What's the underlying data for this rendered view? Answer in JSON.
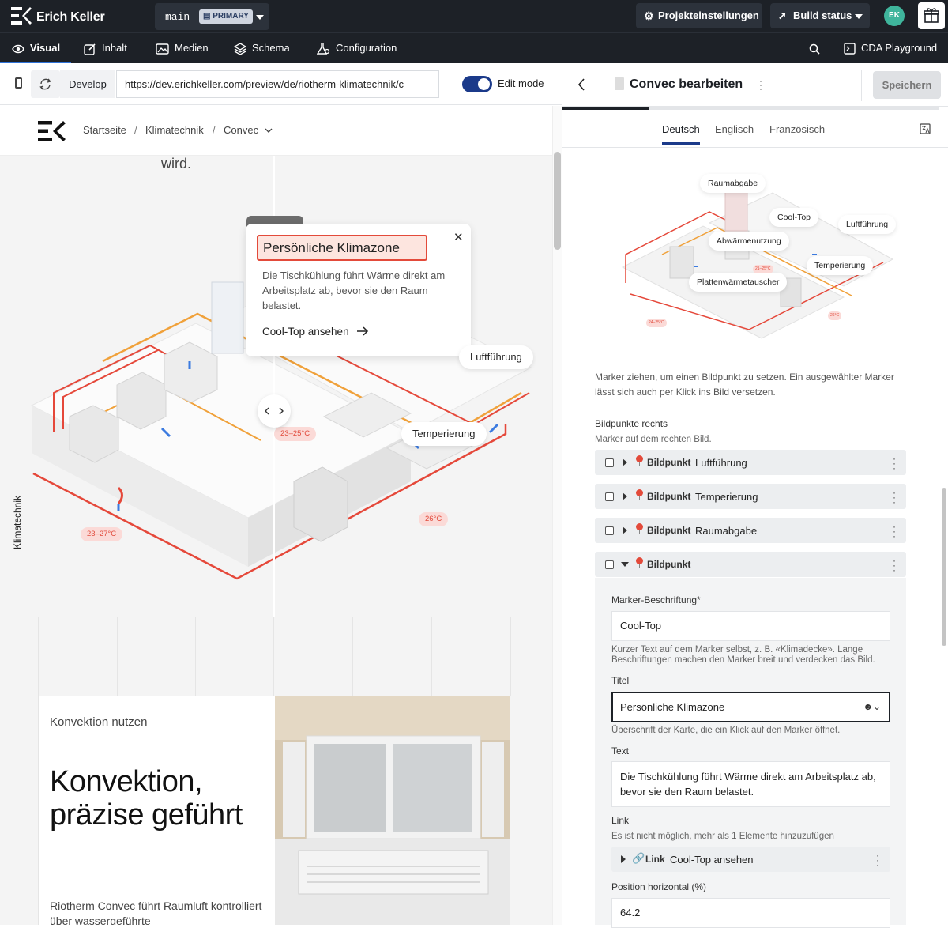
{
  "topbar": {
    "brand": "Erich Keller",
    "branch": "main",
    "branch_badge": "PRIMARY",
    "project_settings": "Projekteinstellungen",
    "build_status": "Build status",
    "avatar_initials": "EK"
  },
  "nav": {
    "items": [
      "Visual",
      "Inhalt",
      "Medien",
      "Schema",
      "Configuration"
    ],
    "cda": "CDA Playground"
  },
  "address": {
    "env": "Develop",
    "url": "https://dev.erichkeller.com/preview/de/riotherm-klimatechnik/c",
    "edit_mode": "Edit mode"
  },
  "preview": {
    "breadcrumb": [
      "Startseite",
      "Klimatechnik",
      "Convec"
    ],
    "intro_tail": "wird.",
    "side_label": "Klimatechnik",
    "popup": {
      "title": "Persönliche Klimazone",
      "text": "Die Tischkühlung führt Wärme direkt am Arbeitsplatz ab, bevor sie den Raum belastet.",
      "link": "Cool-Top ansehen"
    },
    "chips": [
      "Luftführung",
      "Temperierung"
    ],
    "temps": [
      "23–25°C",
      "23–27°C",
      "26°C"
    ],
    "section": {
      "eyebrow": "Konvektion nutzen",
      "headline": "Konvektion, präzise geführt",
      "body": "Riotherm Convec führt Raumluft kontrolliert über wassergeführte"
    }
  },
  "editor": {
    "title": "Convec bearbeiten",
    "save": "Speichern",
    "tabs": [
      "Deutsch",
      "Englisch",
      "Französisch"
    ],
    "thumb_labels": [
      "Raumabgabe",
      "Cool-Top",
      "Luftführung",
      "Abwärmenutzung",
      "Temperierung",
      "Plattenwärmetauscher"
    ],
    "thumb_temps": [
      "21–25°C",
      "24–25°C",
      "26°C"
    ],
    "hint": "Marker ziehen, um einen Bildpunkt zu setzen. Ein ausgewählter Marker lässt sich auch per Klick ins Bild versetzen.",
    "points_label": "Bildpunkte rechts",
    "points_sub": "Marker auf dem rechten Bild.",
    "point_kind": "Bildpunkt",
    "points": [
      "Luftführung",
      "Temperierung",
      "Raumabgabe"
    ],
    "marker_label": "Marker-Beschriftung*",
    "marker_value": "Cool-Top",
    "marker_help": "Kurzer Text auf dem Marker selbst, z. B. «Klimadecke». Lange Beschriftungen machen den Marker breit und verdecken das Bild.",
    "title_label": "Titel",
    "title_value": "Persönliche Klimazone",
    "title_help": "Überschrift der Karte, die ein Klick auf den Marker öffnet.",
    "text_label": "Text",
    "text_value": "Die Tischkühlung führt Wärme direkt am Arbeitsplatz ab, bevor sie den Raum belastet.",
    "link_label": "Link",
    "link_help": "Es ist nicht möglich, mehr als 1 Elemente hinzuzufügen",
    "link_kind": "Link",
    "link_value": "Cool-Top ansehen",
    "pos_label": "Position horizontal (%)",
    "pos_value": "64.2"
  },
  "colors": {
    "accent": "#1b3a8a",
    "marker_red": "#e34a3a",
    "bar_dark": "#1d2127"
  }
}
